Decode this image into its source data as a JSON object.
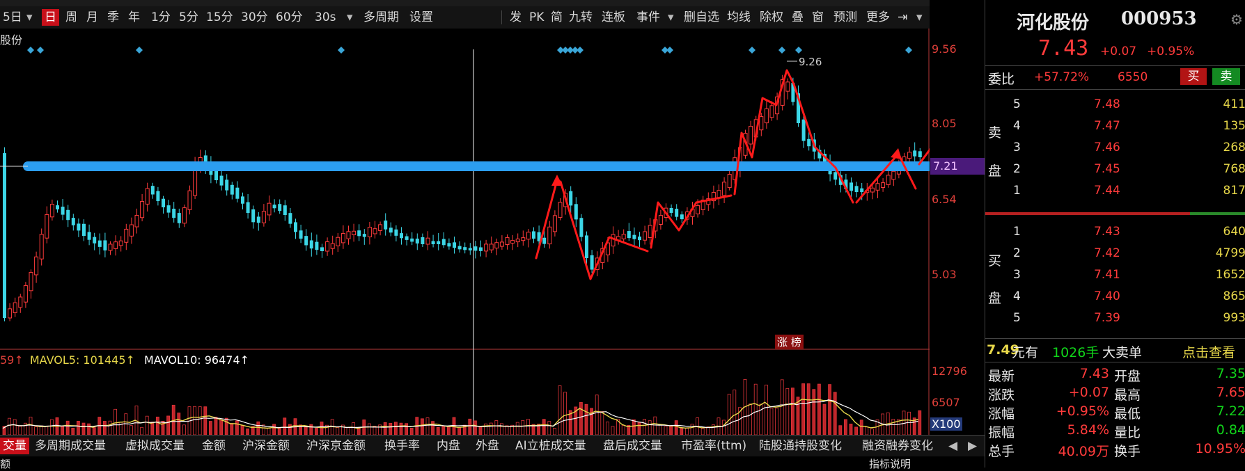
{
  "toolbar": {
    "period_left": "5日",
    "items": [
      "日",
      "周",
      "月",
      "季",
      "年",
      "1分",
      "5分",
      "15分",
      "30分",
      "60分",
      "30s",
      "多周期",
      "设置"
    ],
    "active": "日",
    "right_items": [
      "发",
      "PK",
      "简",
      "九转",
      "连板",
      "事件",
      "删自选",
      "均线",
      "除权",
      "叠",
      "窗",
      "预测",
      "更多"
    ]
  },
  "chart": {
    "stock_label_left": "股份",
    "price_ticks": [
      "9.56",
      "8.05",
      "7.21",
      "6.54",
      "5.03"
    ],
    "highlight_price": "7.21",
    "peak_label": "9.26",
    "zhang_bang": "涨 榜",
    "volume_header": {
      "prefix": "59↑",
      "mavol5": "MAVOL5: 101445↑",
      "mavol10": "MAVOL10: 96474↑"
    },
    "volume_ticks": [
      "12796",
      "6507",
      "X100"
    ],
    "colors": {
      "up": "#ff3b3b",
      "down": "#3cd6e6",
      "line": "#2c9ef0",
      "ma5": "#e8d84a",
      "ma10": "#ffffff"
    }
  },
  "bottom_tabs": {
    "items": [
      "交量",
      "多周期成交量",
      "虚拟成交量",
      "金额",
      "沪深金额",
      "沪深京金额",
      "换手率",
      "内盘",
      "外盘",
      "AI立桩成交量",
      "盘后成交量",
      "市盈率(ttm)",
      "陆股通持股变化",
      "融资融券变化"
    ],
    "active": "交量",
    "footer_text": "指标说明",
    "footer_left": "额"
  },
  "quote": {
    "name": "河化股份",
    "code": "000953",
    "price": "7.43",
    "change": "+0.07",
    "change_pct": "+0.95%",
    "weibi_label": "委比",
    "weibi_value": "+57.72%",
    "weicha": "6550",
    "buy_btn": "买",
    "sell_btn": "卖",
    "sell_label": [
      "卖",
      "盘"
    ],
    "buy_label": [
      "买",
      "盘"
    ],
    "asks": [
      {
        "level": "5",
        "price": "7.48",
        "vol": "411"
      },
      {
        "level": "4",
        "price": "7.47",
        "vol": "135"
      },
      {
        "level": "3",
        "price": "7.46",
        "vol": "268"
      },
      {
        "level": "2",
        "price": "7.45",
        "vol": "768"
      },
      {
        "level": "1",
        "price": "7.44",
        "vol": "817"
      }
    ],
    "bids": [
      {
        "level": "1",
        "price": "7.43",
        "vol": "640"
      },
      {
        "level": "2",
        "price": "7.42",
        "vol": "4799"
      },
      {
        "level": "3",
        "price": "7.41",
        "vol": "1652"
      },
      {
        "level": "4",
        "price": "7.40",
        "vol": "865"
      },
      {
        "level": "5",
        "price": "7.39",
        "vol": "993"
      }
    ],
    "big_order": {
      "price": "7.49",
      "unit": "元有",
      "qty": "1026手",
      "label": "大卖单",
      "link": "点击查看"
    },
    "stats": [
      {
        "l": "最新",
        "v": "7.43",
        "l2": "开盘",
        "v2": "7.35"
      },
      {
        "l": "涨跌",
        "v": "+0.07",
        "l2": "最高",
        "v2": "7.65"
      },
      {
        "l": "涨幅",
        "v": "+0.95%",
        "l2": "最低",
        "v2": "7.22"
      },
      {
        "l": "振幅",
        "v": "5.84%",
        "l2": "量比",
        "v2": "0.84"
      },
      {
        "l": "总手",
        "v": "40.09万",
        "l2": "换手",
        "v2": "10.95%"
      }
    ]
  }
}
